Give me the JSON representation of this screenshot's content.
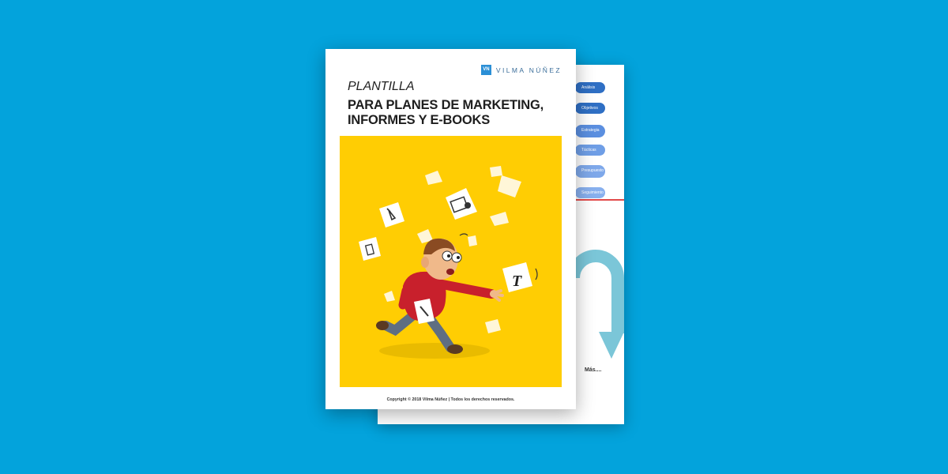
{
  "background_color": "#03a3dc",
  "back_page": {
    "menu_items": [
      {
        "label": "Análisis",
        "color": "#2f6fc4"
      },
      {
        "label": "Objetivos",
        "color": "#2f6fc4"
      },
      {
        "label": "Estrategia",
        "color": "#5b8fe0"
      },
      {
        "label": "Tácticas",
        "color": "#6f9ee6"
      },
      {
        "label": "Presupuesto",
        "color": "#7ea8ea"
      },
      {
        "label": "Seguimiento",
        "color": "#88b0ee"
      }
    ],
    "more_label": "Más....",
    "arrow_color": "#7bc6d8",
    "divider_color": "#e24a4a"
  },
  "front_page": {
    "brand": {
      "mark": "VN",
      "name": "VILMA NÚÑEZ",
      "mark_color": "#2b8fd6"
    },
    "kicker": "PLANTILLA",
    "title_lines": [
      "PARA PLANES DE MARKETING,",
      "INFORMES Y E-BOOKS"
    ],
    "illustration": {
      "background_color": "#ffcd03",
      "subject": "man-chasing-papers",
      "paper_glyph": "T"
    },
    "copyright": "Copyright © 2018 Vilma Núñez | Todos los derechos reservados."
  }
}
